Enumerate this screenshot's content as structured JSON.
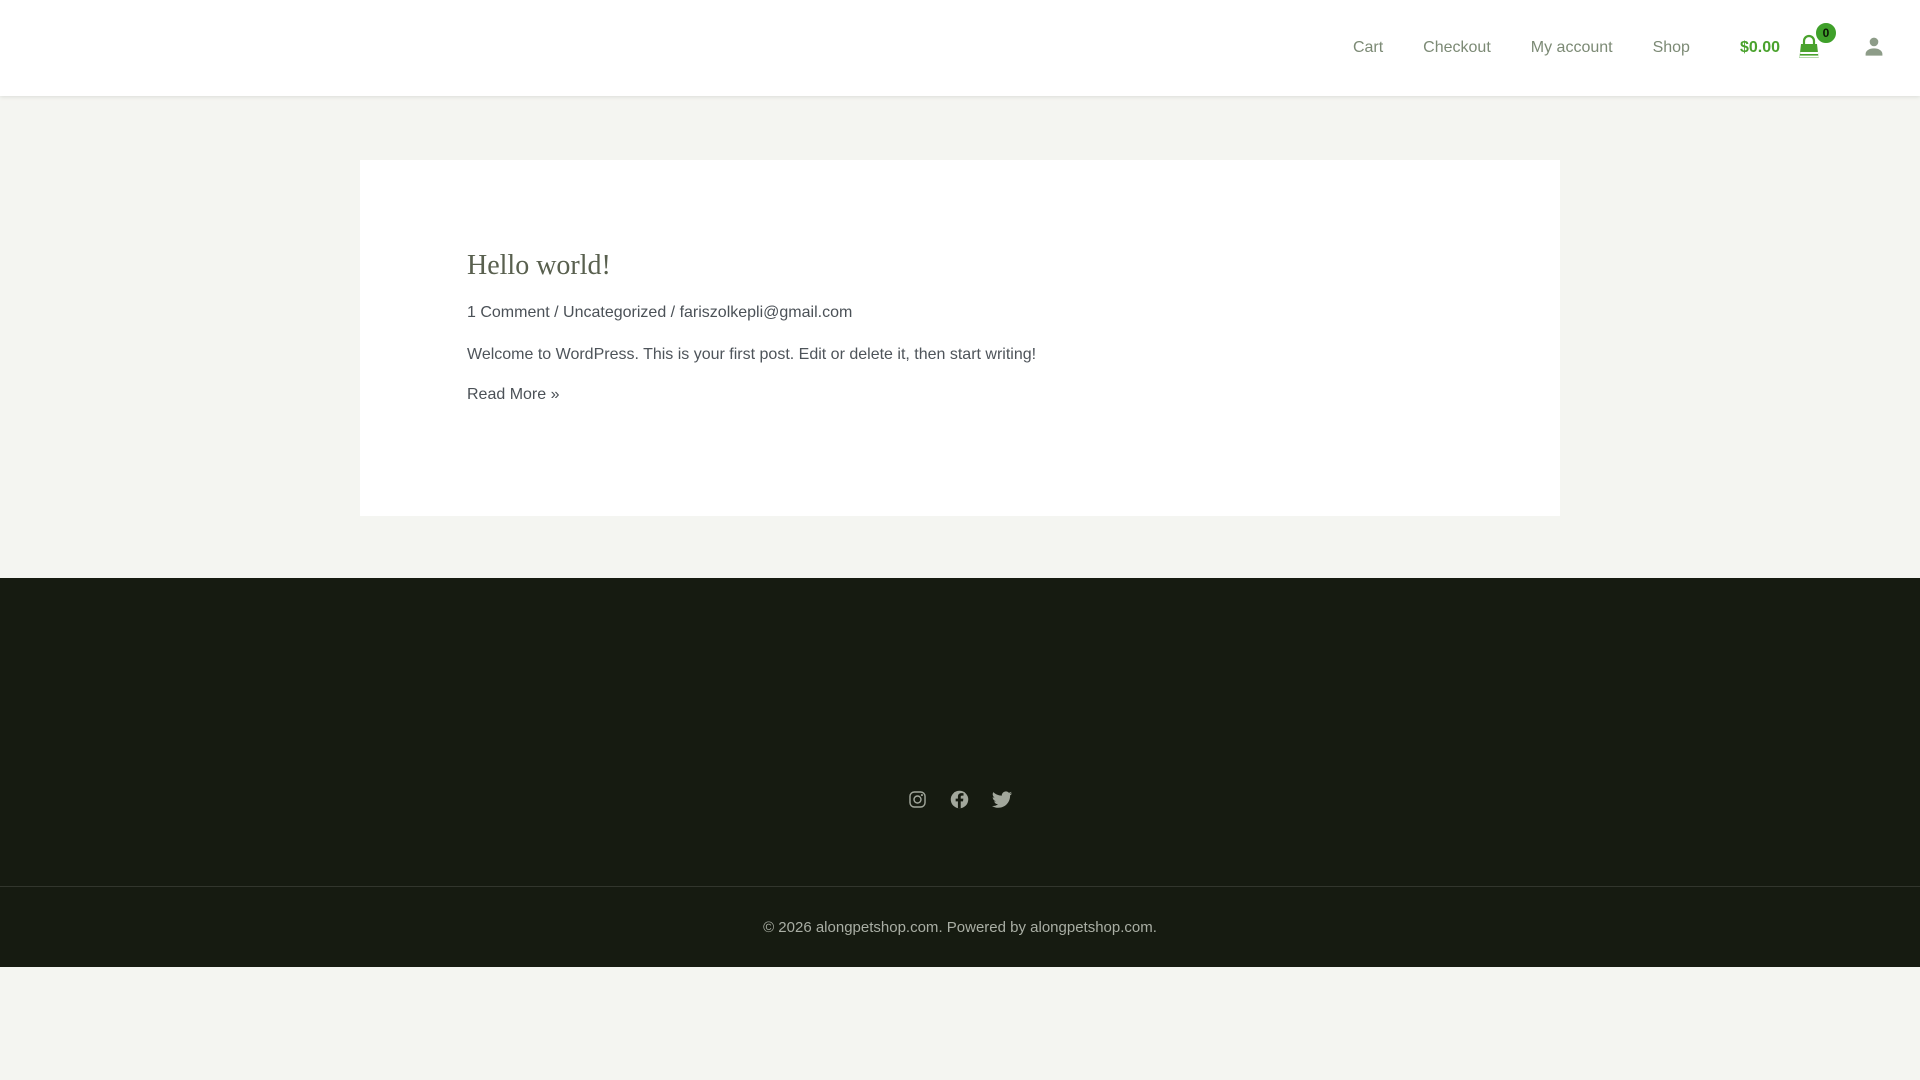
{
  "header": {
    "nav_items": [
      {
        "label": "Cart"
      },
      {
        "label": "Checkout"
      },
      {
        "label": "My account"
      },
      {
        "label": "Shop"
      }
    ],
    "cart_total": "$0.00",
    "cart_count": "0"
  },
  "post": {
    "title": "Hello world!",
    "meta": {
      "comments": "1 Comment",
      "sep1": " / ",
      "category": "Uncategorized",
      "sep2": " / ",
      "author": "fariszolkepli@gmail.com"
    },
    "excerpt": "Welcome to WordPress. This is your first post. Edit or delete it, then start writing!",
    "read_more": "Read More »"
  },
  "footer": {
    "social": [
      {
        "name": "instagram"
      },
      {
        "name": "facebook"
      },
      {
        "name": "twitter"
      }
    ],
    "copyright": {
      "prefix": "© 2026 ",
      "site_link": "alongpetshop.com",
      "middle": ". Powered by ",
      "powered_link": "alongpetshop.com",
      "suffix": "."
    }
  },
  "colors": {
    "accent_green": "#4aa22d",
    "badge_green": "#3fa02a",
    "nav_link": "#7c8a75",
    "account_icon": "#8d9c88",
    "page_bg": "#f4f5f1",
    "card_bg": "#ffffff",
    "title_text": "#59604f",
    "body_text": "#4b5157",
    "footer_bg": "#161b11",
    "footer_text": "#a9aea4",
    "social_icon": "#a2a79c"
  }
}
